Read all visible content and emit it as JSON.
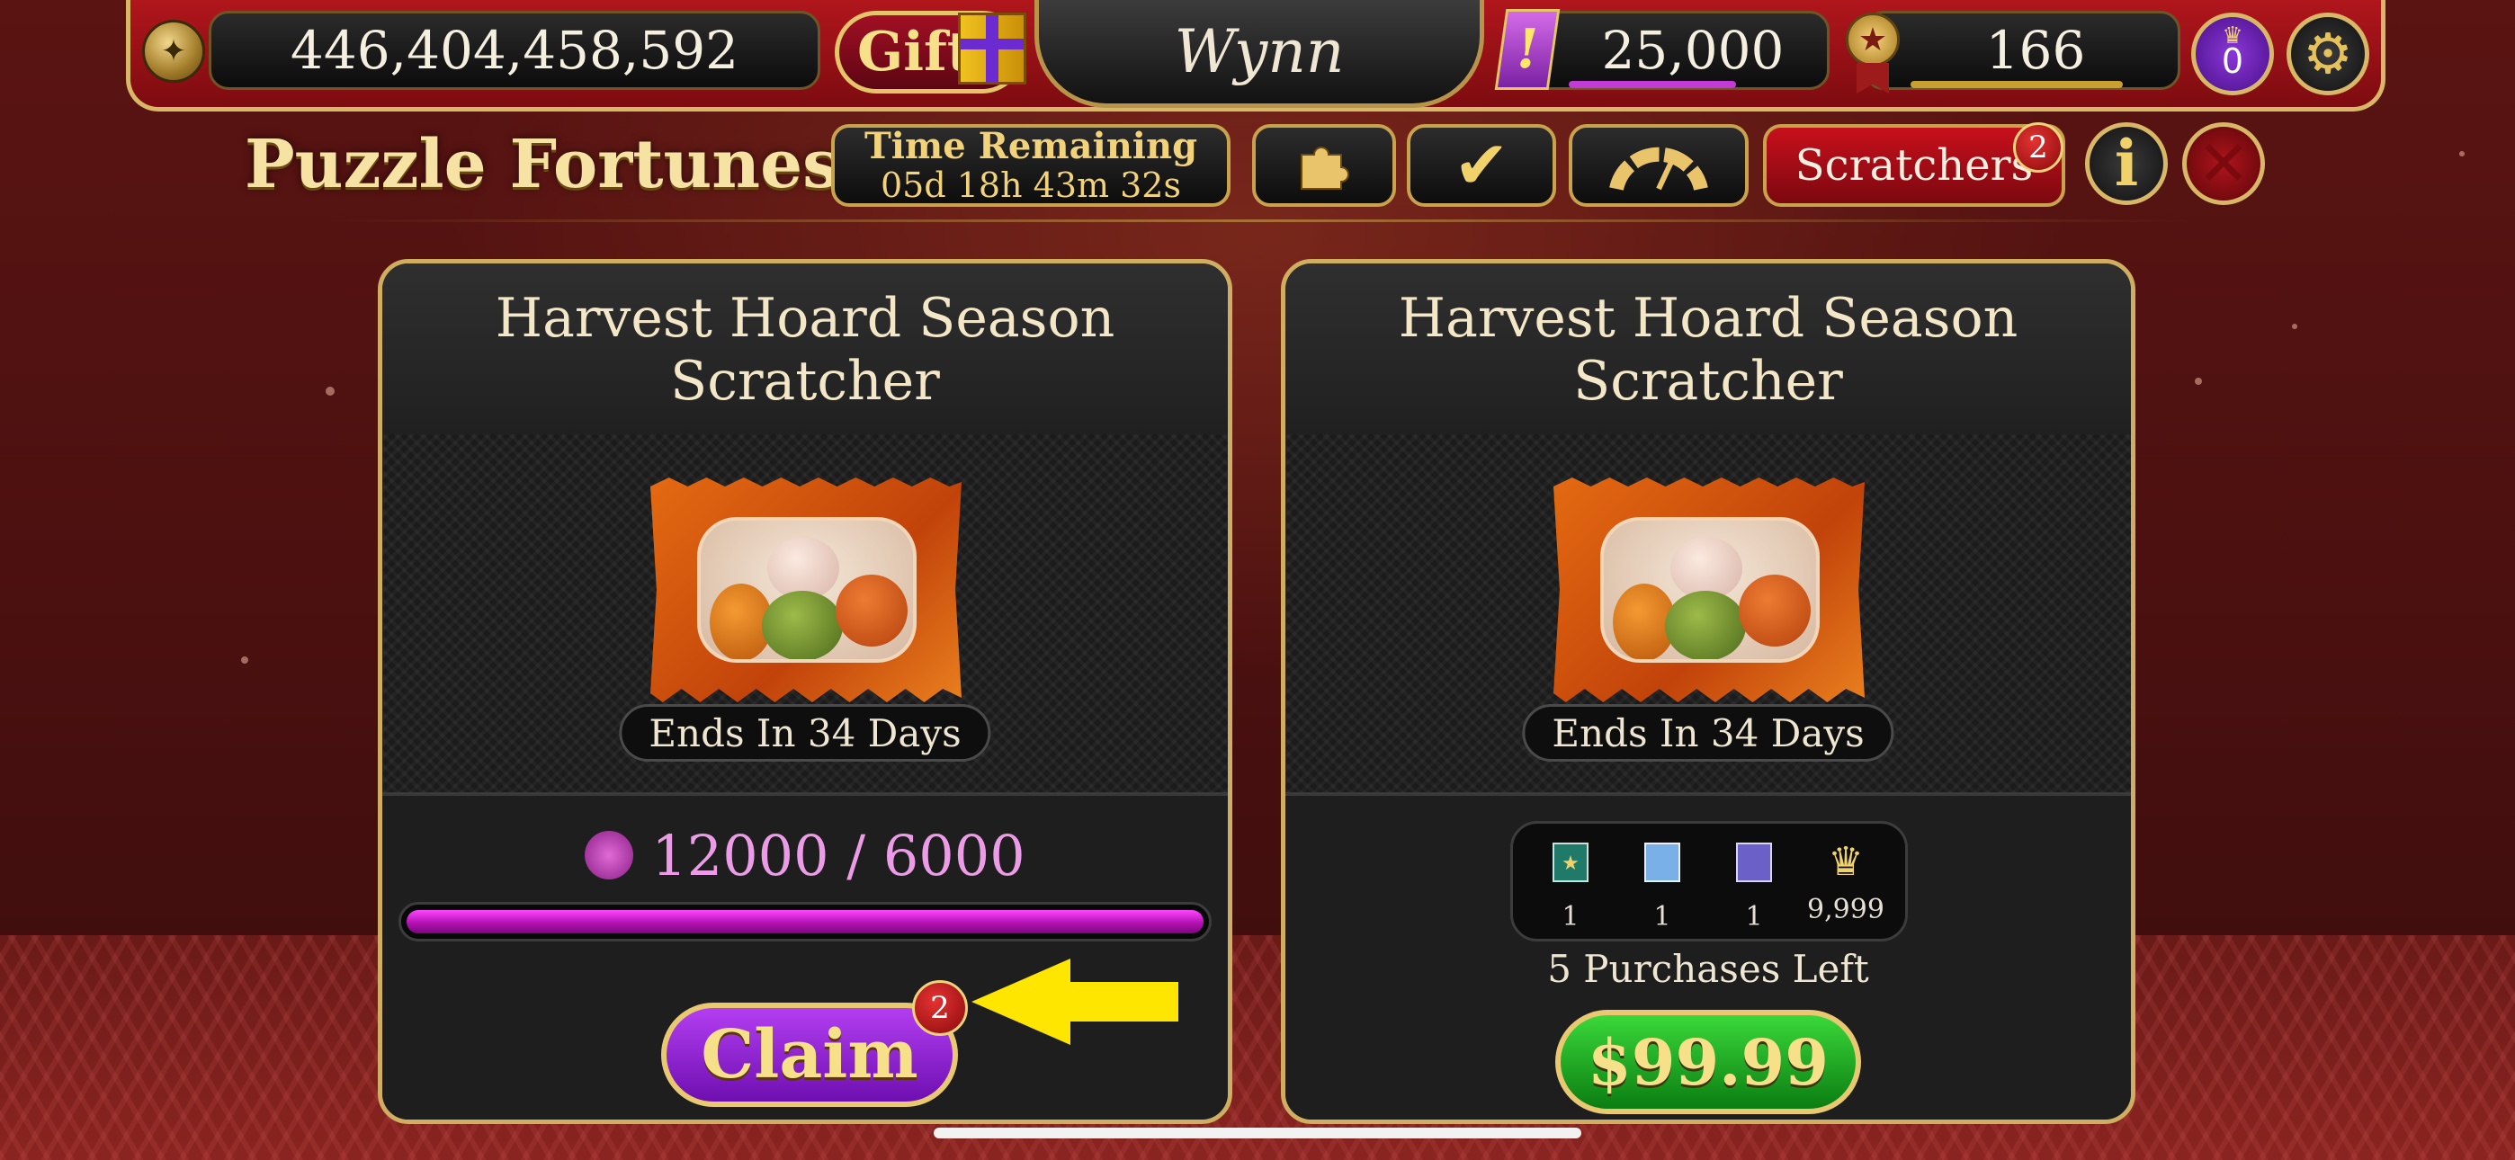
{
  "top_bar": {
    "coins": "446,404,458,592",
    "gift_label": "Gift",
    "logo_text": "Wynn",
    "gems": "25,000",
    "level": "166",
    "crown_count": "0"
  },
  "header": {
    "title": "Puzzle Fortunes",
    "time_title": "Time Remaining",
    "time_value": "05d 18h 43m 32s",
    "scratchers_label": "Scratchers",
    "scratchers_badge": "2"
  },
  "cards": [
    {
      "title_line1": "Harvest Hoard Season",
      "title_line2": "Scratcher",
      "ends": "Ends In 34 Days",
      "progress_text": "12000 / 6000",
      "progress_fraction": 1.0,
      "claim_label": "Claim",
      "claim_badge": "2"
    },
    {
      "title_line1": "Harvest Hoard Season",
      "title_line2": "Scratcher",
      "ends": "Ends In 34 Days",
      "rewards": [
        "1",
        "1",
        "1",
        "9,999"
      ],
      "purchases_left": "5 Purchases Left",
      "price": "$99.99"
    }
  ],
  "colors": {
    "accent_gold": "#cfae62",
    "claim_purple": "#8a1fd0",
    "buy_green": "#18a81f",
    "progress_magenta": "#e03ae0",
    "arrow_yellow": "#ffe600"
  },
  "icons": [
    "wynn-coin-icon",
    "gift-box-icon",
    "gem-icon",
    "medal-icon",
    "crown-icon",
    "gear-icon",
    "puzzle-icon",
    "checkmark-icon",
    "gauge-icon",
    "info-icon",
    "close-icon",
    "scratch-token-icon",
    "arrow-pointer-icon"
  ]
}
